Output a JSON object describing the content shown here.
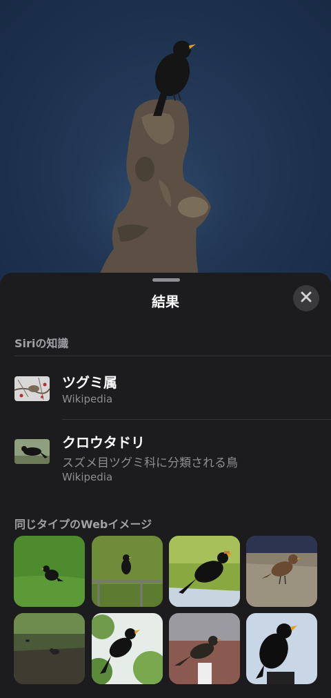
{
  "sheet": {
    "title": "結果",
    "close_icon": "xmark-icon"
  },
  "siri_section": {
    "label": "Siriの知識"
  },
  "results": [
    {
      "title": "ツグミ属",
      "subtitle": "",
      "source": "Wikipedia"
    },
    {
      "title": "クロウタドリ",
      "subtitle": "スズメ目ツグミ科に分類される鳥",
      "source": "Wikipedia"
    }
  ],
  "web_section": {
    "label": "同じタイプのWebイメージ"
  },
  "colors": {
    "sheet_bg": "#1c1c1e",
    "secondary_text": "#8e8e93",
    "photo_sky": "#1e3350"
  }
}
